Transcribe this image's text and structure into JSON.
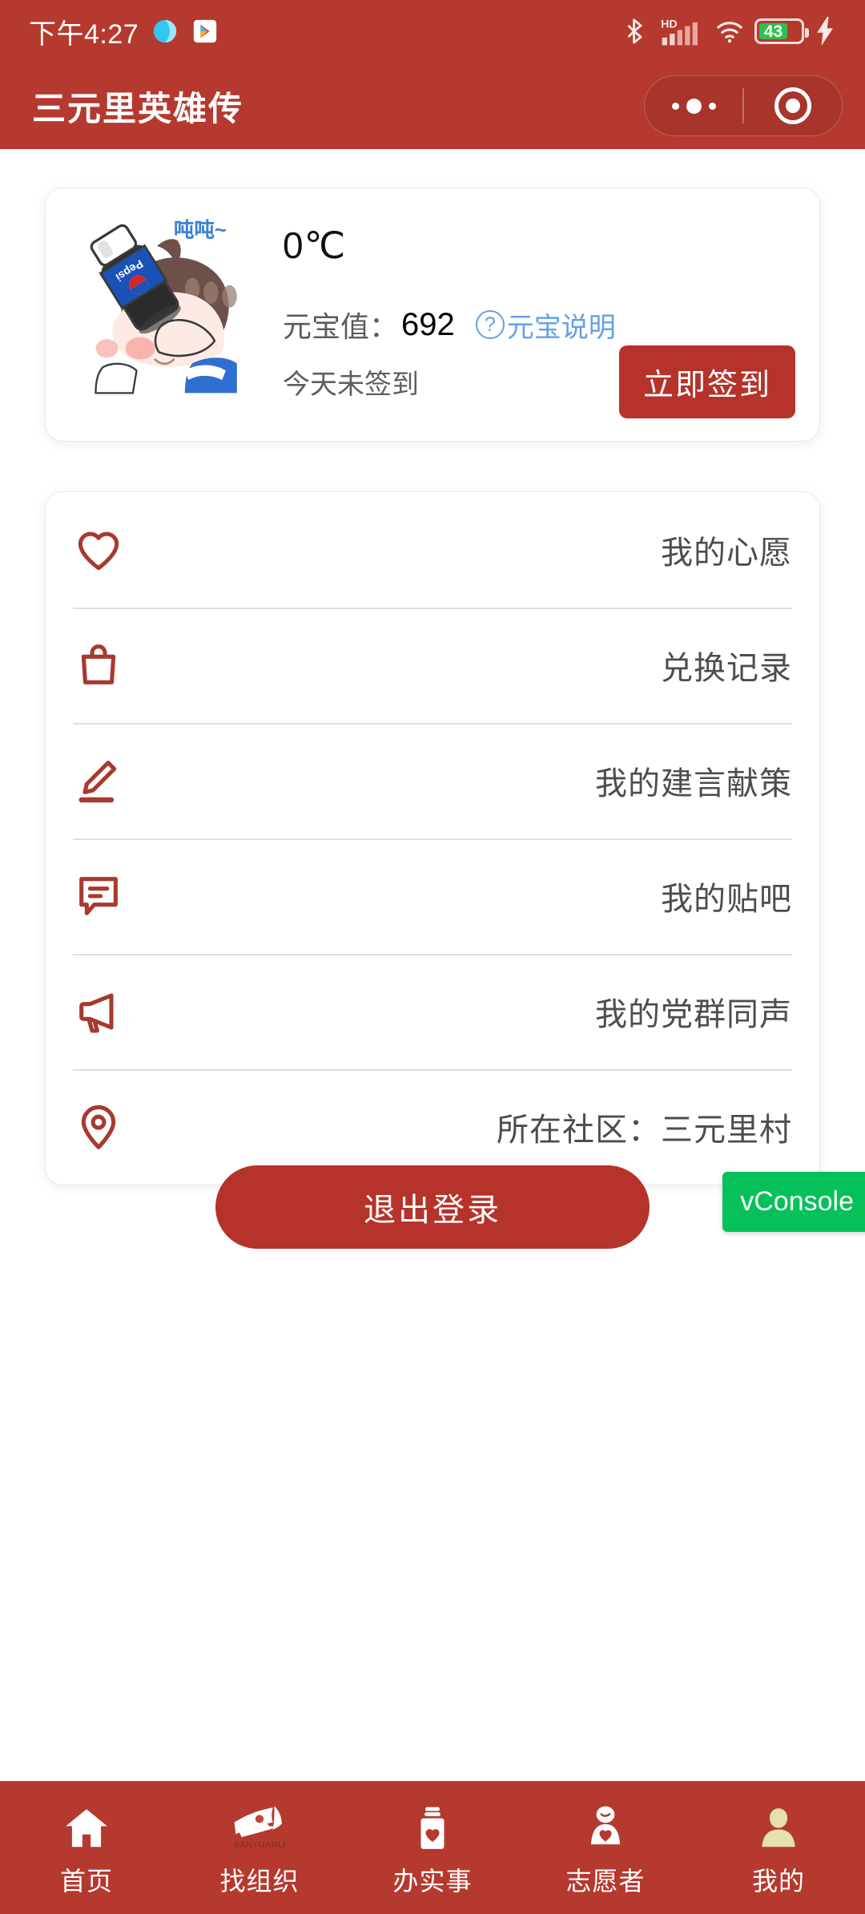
{
  "colors": {
    "brand_red": "#b5392f",
    "button_red": "#b5332a",
    "icon_red": "#a8392f",
    "link_blue": "#63a0e8",
    "vconsole_green": "#06c15a",
    "active_tab": "#e6dfae",
    "battery_green": "#2cc14e"
  },
  "status_bar": {
    "time": "下午4:27",
    "icons_left": [
      "browser-icon",
      "play-store-icon"
    ],
    "icons_right": [
      "bluetooth-icon",
      "hd-icon",
      "signal-icon",
      "wifi-icon"
    ],
    "battery_level": "43",
    "charging": true
  },
  "header": {
    "title": "三元里英雄传",
    "capsule": {
      "more_icon": "more-dots-icon",
      "target_icon": "target-icon"
    }
  },
  "profile": {
    "avatar_alt": "卡通头像",
    "avatar_bubble_text": "吨吨~",
    "avatar_brand_text": "Pepsi",
    "temperature": "0℃",
    "coins_label": "元宝值：",
    "coins_value": "692",
    "help_link": "元宝说明",
    "help_icon": "question-circle-icon",
    "sign_status": "今天未签到",
    "sign_button": "立即签到"
  },
  "menu": {
    "items": [
      {
        "icon": "heart-icon",
        "label": "我的心愿"
      },
      {
        "icon": "bag-icon",
        "label": "兑换记录"
      },
      {
        "icon": "pencil-icon",
        "label": "我的建言献策"
      },
      {
        "icon": "comment-icon",
        "label": "我的贴吧"
      },
      {
        "icon": "megaphone-icon",
        "label": "我的党群同声"
      },
      {
        "icon": "location-icon",
        "label": "所在社区：三元里村"
      }
    ]
  },
  "actions": {
    "logout_label": "退出登录",
    "vconsole_label": "vConsole"
  },
  "tabbar": {
    "items": [
      {
        "icon": "home-icon",
        "label": "首页",
        "active": false
      },
      {
        "icon": "flag-logo-icon",
        "label": "找组织",
        "active": false,
        "logo_text": "SANYUANLI"
      },
      {
        "icon": "jar-heart-icon",
        "label": "办实事",
        "active": false
      },
      {
        "icon": "volunteer-icon",
        "label": "志愿者",
        "active": false
      },
      {
        "icon": "person-icon",
        "label": "我的",
        "active": true
      }
    ]
  }
}
